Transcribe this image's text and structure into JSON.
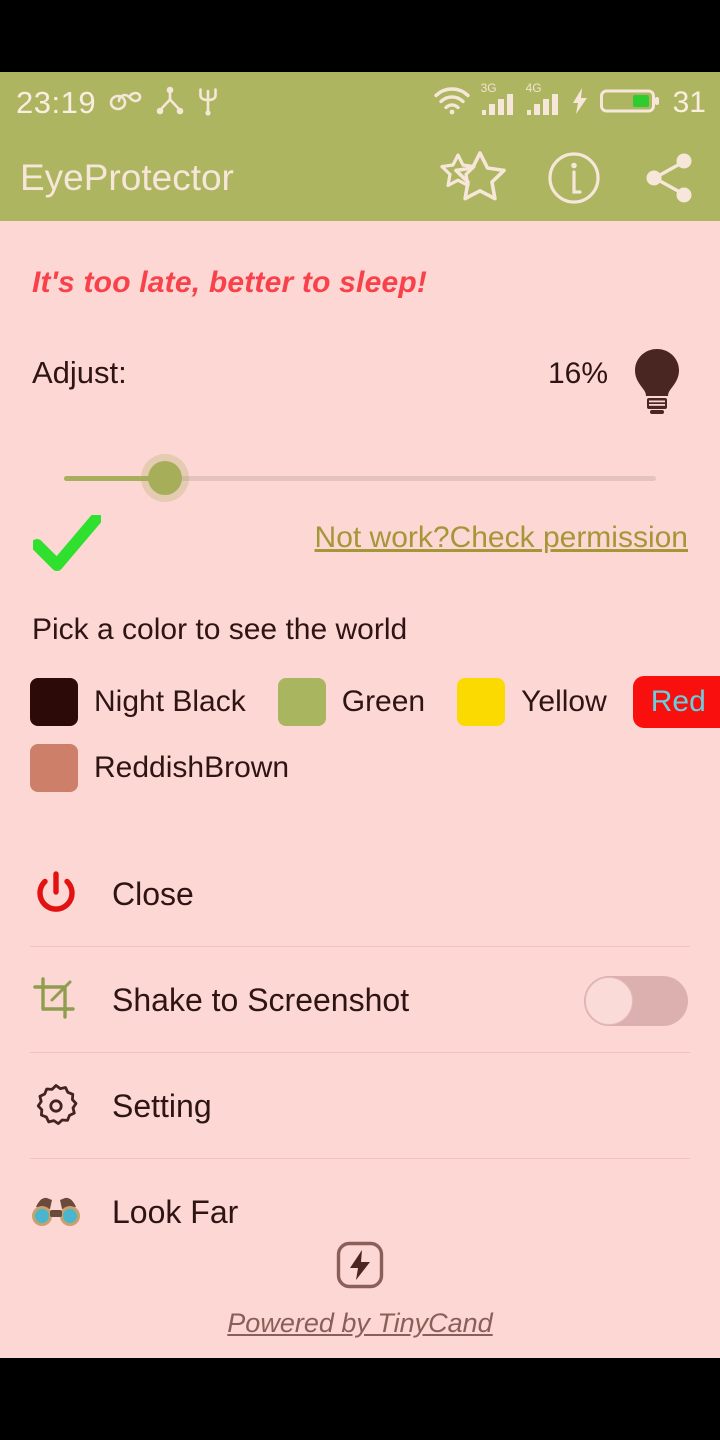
{
  "statusbar": {
    "time": "23:19",
    "battery_percent": "31",
    "left_icons": [
      "infinity-icon",
      "network-share-icon",
      "usb-icon"
    ],
    "right_icons": [
      "wifi-icon",
      "signal-3g-icon",
      "signal-4g-icon",
      "charging-bolt-icon",
      "battery-icon"
    ],
    "signal_1_label": "3G",
    "signal_2_label": "4G"
  },
  "toolbar": {
    "title": "EyeProtector",
    "actions": [
      {
        "name": "rate-stars-icon",
        "label": "Rate"
      },
      {
        "name": "info-icon",
        "label": "Info"
      },
      {
        "name": "share-icon",
        "label": "Share"
      }
    ]
  },
  "main": {
    "warning": "It's too late, better to sleep!",
    "adjust_label": "Adjust:",
    "adjust_percent": "16%",
    "bulb_icon": "lightbulb-icon",
    "slider": {
      "value": 16,
      "min": 0,
      "max": 100
    },
    "check_icon": "checkmark-icon",
    "permission_link": "Not work?Check permission",
    "pick_color_title": "Pick a color to see the world",
    "colors": [
      {
        "label": "Night Black",
        "hex": "#2b0a08",
        "selected": false
      },
      {
        "label": "Green",
        "hex": "#aab560",
        "selected": false
      },
      {
        "label": "Yellow",
        "hex": "#fada00",
        "selected": false
      },
      {
        "label": "Red",
        "hex": "#fa0f0f",
        "selected": true
      },
      {
        "label": "ReddishBrown",
        "hex": "#cd7f6a",
        "selected": false
      }
    ],
    "menu": [
      {
        "label": "Close",
        "icon": "power-icon",
        "toggle": null
      },
      {
        "label": "Shake to Screenshot",
        "icon": "screenshot-crop-icon",
        "toggle": "off"
      },
      {
        "label": "Setting",
        "icon": "gear-icon",
        "toggle": null
      },
      {
        "label": "Look Far",
        "icon": "binoculars-icon",
        "toggle": null
      }
    ]
  },
  "footer": {
    "icon": "bolt-square-icon",
    "text": "Powered by TinyCand"
  },
  "theme": {
    "header": "#aeb560",
    "background": "#fcd7d3",
    "warning_text": "#f8414b",
    "link": "#a59737",
    "body_text": "#2e1513",
    "accent_green": "#a7ae5c",
    "selected_text": "#66cfe0"
  }
}
